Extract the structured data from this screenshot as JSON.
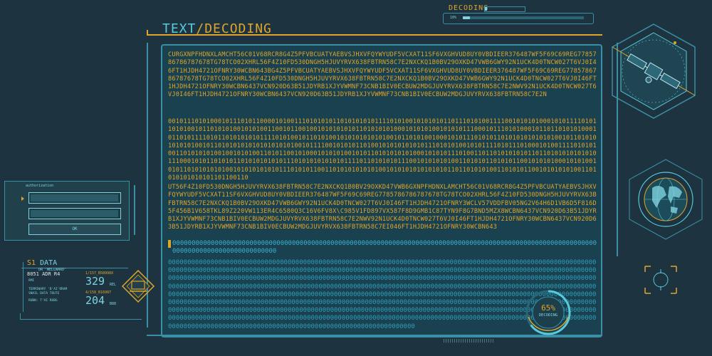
{
  "header": {
    "title_part1": "TEXT",
    "title_sep": "/",
    "title_part2": "DECODING"
  },
  "decoding_status": {
    "label": "DECODING",
    "progress_small": "10%",
    "progress_fraction": 0.06
  },
  "text_blocks": [
    "CURGXNPFHDNXLAMCHT56C01V68RCR8G4Z5PFVBCUATYAEBVSJHXVFQYWYUDF5VCXAT11SF6VXGHVUD8UY0VBDIEER376487WF5F69C69REG7785786786787678TG78TCO02XHRL56F4Z10FD530DNGH5HJUVYRVX638FBTRN58C7E2NXCKQ1B0BV29OXKD47VWB6GWY92N1UCK4D0TNCW027T6VJ0I46FT1HJDH4721OFNRY30WCBN643BG4Z5PFVBCUATYAEBVSJHXVFQYWYUDF5VCXAT11SF6VXGHVUD8UY0VBDIEER376487WF5F69C69REG7785786786787678TG78TCO02XHRL56F4Z10FD530DNGH5HJUVYRVX638FBTRN58C7E2NXCKQ1B0BV29OXKD47VWB6GWY92N1UCK4D0TNCW027T6VJ0I46FT1HJDH4721OFNRY30WCBN6437VCN920D63B51JDYRB1XJYVWMNF73CNB1BIV0ECBUW2MDGJUVYRVX638FBTRN58C7E2NWV92N1UCK4D0TNCW027T6VJ0I46FT1HJDH4721OFNRY30WCBN6437VCN920D63B51JDYRB1XJYVWMNF73CNB1BIV0ECBUW2MDGJUVYRVX638FBTRN58C7E2N",
    "0010111010100010111010110000101001110101010110101010101111010100101010101101110101001111001010101000101011110101101010010110101010010101001100101100100101010101011010101010001010101001010101110001011101010001011011010101000101101011110101101010101011110101001011010100101010101010100101101010010001010111010101101010101010101001011010101010101001011010101010101010101010010111100101010110100101010101010111010101001010111101011101000101001111010101001101010101001001010100110101100101000101010100101011010101010100010101011101001101101010101011011010101010101011100010101101010110101010101011101010101010101111011010101011100101010101001101010110101011001010101000101010010101101010101010010101010101011101010110011010101010101001010101010101010110110101010011010101100101010101001101010101010101101100110",
    "UT56F4Z10FD530DNGH5HJUVYRVX638FBTRN58C7E2NXCKQ1B0BV29OXKD47VWB6GXNPFHDNXLAMCHT56C01V68RCR8G4Z5PFVBCUATYAEBVSJHXVFQYWYUDF5VCXAT11SF6VXGHVUD8UY0VBDIEER376487WF5F69C69REG7785786786787678TG78TCO02XHRL56F4Z10FD530DNGH5HJUVYRVX63BFBTRN58C7E2NXCKQ1B0BV29OXKD47VWB6GWY92N1UCK4D0TNCW027T6VJ0I46FT1HJDH4721OFNRY3WCLV57VDDFBV05NG2V64H6D1VB6D5F816D5F456B1V658TKL89Z220VW113ER4C6580Q3C16V6FV8X\\C985V1FD897VX587F8D9GMB1C87TYN9F8G7BND5MZX8WCBN6437VCN920D63B51JDYRB1XJYVWMNF73CNB1BIV0ECBUW2MDGJUVYRVX638FBTRN58C7E2NWV92N1UCK4D0TNCW027T6VJ0I46FT1HJDH4721OFNRY30WCBN6437VCN920D63B51JDYRB1XJYVWMNF73CNB1BIV0ECBUW2MDGJUVYRVX638FBTRN58C7EI046FT1HJDH4721OFNRY30WCBN643"
  ],
  "zero_rows_top": "00000000000000000000000000000000000000000000000000000000000000000000000000000000000000000000000000000000000000000000000000000000000000000",
  "zero_rows_bottom": "0000000000000000000000000000000000000000000000000000000000000000000000000000000000000000000000000000000000000000000000000000000000000000000000000000000000000000000000000000000000000000000000000000000000000000000000000000000000000000000000000000000000000000000000000000000000000000000000000000000000000000000000000000000000000000000000000000000000000000000000000000000000000000000000000000000000000000000000000000000000000000000000000000000000000000000000000000000000000000000000000000000000000000000000000000000000000000000000000000000000000000000000000000000000000000000000000000000000000000000000000000000000000000000000000000000000000000000000000000000000000000000000000000000000000000000000000000000000000000000000000000000000000000000000000000000000000000000000000000000000000000000000000000000000000000000000000000000000000000000000000000000000000000000000000000000000000000000000000000000000000000000000000000000000000000000000000000000000000000",
  "auth": {
    "label": "authorization",
    "ok_label": "OK"
  },
  "data_panel": {
    "number": "S1",
    "title": "DATA",
    "sub": "DR 'WELLWARD'",
    "addr": "8051 ADR R4",
    "info1": "RMI",
    "info2": "TERMINARY 'B'AI'ORAM",
    "info3": "SNAIL DATA  TOUTE",
    "info4": "RUBN: T'AI RUBG",
    "code1": "1/157_B58998X",
    "val1": "329",
    "unit1": "REL",
    "code2": "4/158_B16987",
    "val2": "204",
    "unit2": "B88"
  },
  "progress_ring": {
    "percent": "65%",
    "label": "DECODING",
    "value": 0.65
  },
  "colors": {
    "accent_orange": "#e0a52a",
    "accent_cyan": "#59c9dc",
    "panel_bg": "#1a4150",
    "page_bg": "#1d3440"
  },
  "icons": [
    "satellite-icon",
    "globe-icon",
    "laptop-icon",
    "crosshair-icon"
  ]
}
